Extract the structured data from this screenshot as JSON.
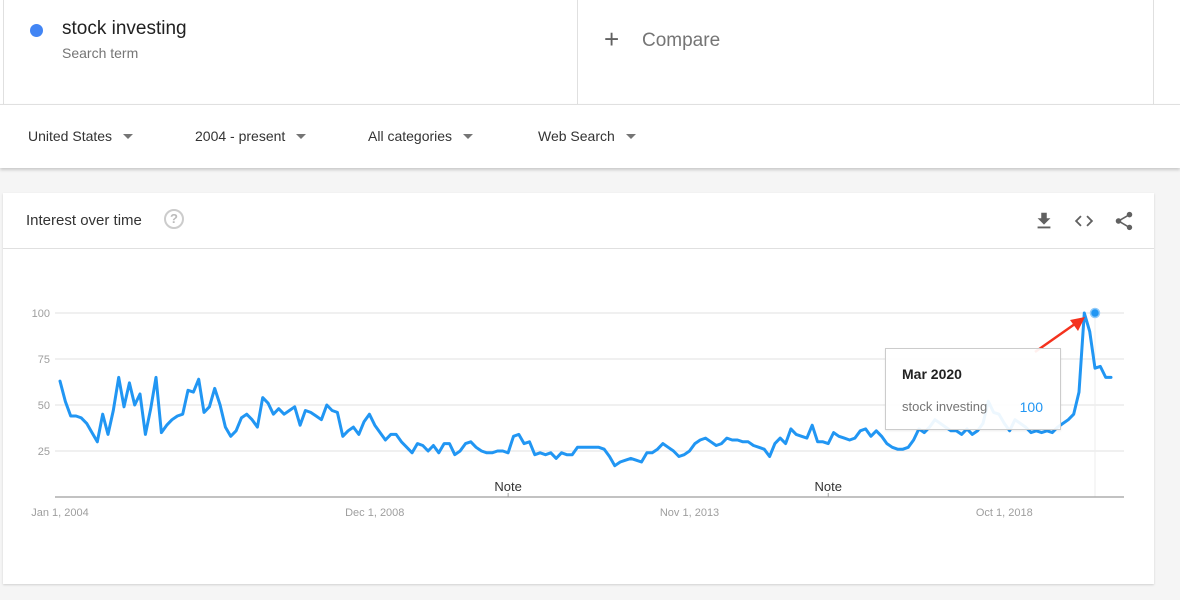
{
  "search_term": {
    "name": "stock investing",
    "subtitle": "Search term",
    "color": "#4285f4"
  },
  "compare": {
    "icon": "plus-icon",
    "plus_glyph": "+",
    "label": "Compare"
  },
  "filters": [
    {
      "label": "United States"
    },
    {
      "label": "2004 - present"
    },
    {
      "label": "All categories"
    },
    {
      "label": "Web Search"
    }
  ],
  "card": {
    "title": "Interest over time",
    "help_glyph": "?",
    "actions": [
      "download-icon",
      "embed-icon",
      "share-icon"
    ]
  },
  "tooltip": {
    "date": "Mar 2020",
    "term": "stock investing",
    "value": "100"
  },
  "chart_data": {
    "type": "line",
    "title": "Interest over time",
    "xlabel": "",
    "ylabel": "",
    "ylim": [
      0,
      100
    ],
    "yticks": [
      25,
      50,
      75,
      100
    ],
    "ytick_labels": [
      "25",
      "50",
      "75",
      "100"
    ],
    "x_start": "2004-01",
    "x_end": "2020-07",
    "xtick_labels": [
      {
        "label": "Jan 1, 2004",
        "month_index": 0
      },
      {
        "label": "Dec 1, 2008",
        "month_index": 59
      },
      {
        "label": "Nov 1, 2013",
        "month_index": 118
      },
      {
        "label": "Oct 1, 2018",
        "month_index": 177
      }
    ],
    "notes": [
      {
        "label": "Note",
        "month_index": 84
      },
      {
        "label": "Note",
        "month_index": 144
      }
    ],
    "grid": true,
    "legend": "none",
    "highlight": {
      "label": "Mar 2020",
      "month_index": 194,
      "value": 100
    },
    "series": [
      {
        "name": "stock investing",
        "color": "#2196f3",
        "values": [
          63,
          52,
          44,
          44,
          43,
          40,
          35,
          30,
          45,
          34,
          47,
          65,
          49,
          62,
          50,
          56,
          34,
          48,
          65,
          35,
          39,
          42,
          44,
          45,
          58,
          57,
          64,
          46,
          49,
          59,
          50,
          38,
          33,
          36,
          43,
          45,
          42,
          38,
          54,
          51,
          45,
          48,
          45,
          47,
          49,
          39,
          47,
          46,
          44,
          42,
          50,
          47,
          46,
          33,
          36,
          38,
          34,
          41,
          45,
          39,
          35,
          31,
          34,
          34,
          30,
          27,
          24,
          29,
          28,
          25,
          28,
          24,
          29,
          29,
          23,
          25,
          29,
          30,
          27,
          25,
          24,
          24,
          25,
          25,
          24,
          33,
          34,
          29,
          30,
          23,
          24,
          23,
          24,
          21,
          24,
          23,
          23,
          27,
          27,
          27,
          27,
          27,
          26,
          22,
          17,
          19,
          20,
          21,
          20,
          19,
          24,
          24,
          26,
          29,
          27,
          25,
          22,
          23,
          25,
          29,
          31,
          32,
          30,
          28,
          29,
          32,
          31,
          31,
          30,
          30,
          28,
          27,
          26,
          22,
          29,
          32,
          29,
          37,
          34,
          33,
          32,
          39,
          30,
          30,
          29,
          35,
          33,
          32,
          31,
          32,
          36,
          37,
          33,
          36,
          33,
          29,
          27,
          26,
          26,
          27,
          31,
          37,
          35,
          38,
          42,
          40,
          38,
          36,
          36,
          34,
          37,
          34,
          36,
          40,
          52,
          46,
          45,
          40,
          36,
          42,
          40,
          38,
          35,
          36,
          35,
          36,
          35,
          38,
          40,
          42,
          45,
          57,
          100,
          90,
          70,
          71,
          65,
          65
        ]
      }
    ]
  }
}
